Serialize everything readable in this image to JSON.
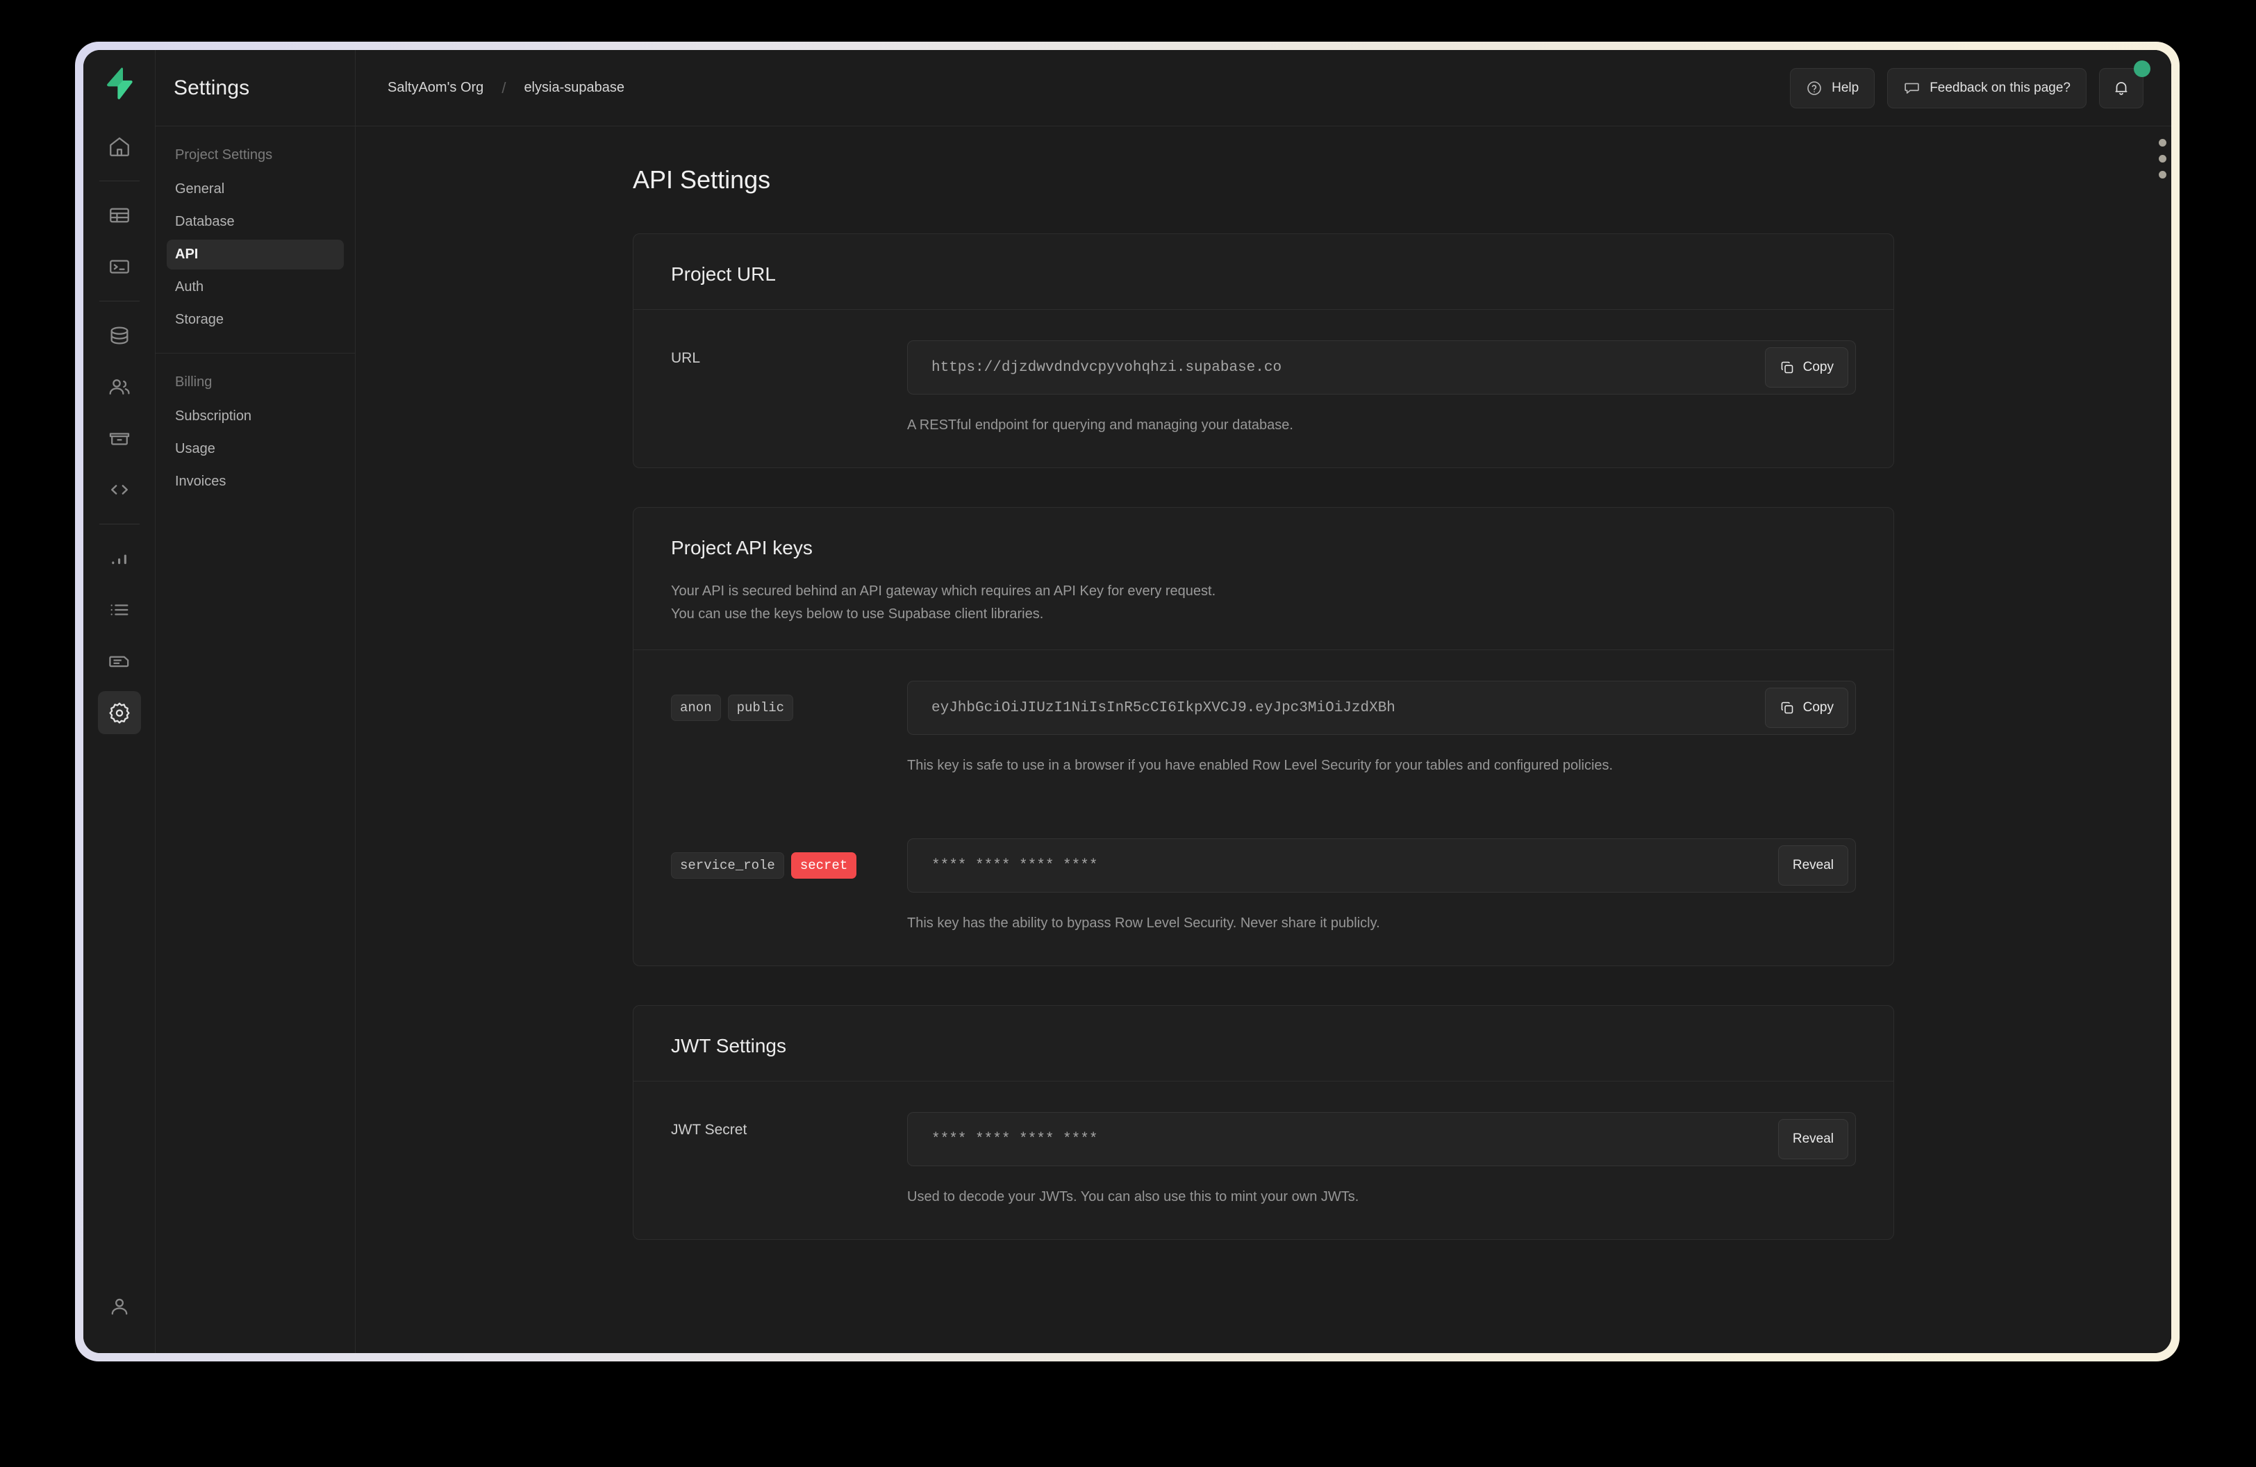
{
  "window": {
    "frame_gradient_left": "#d9d9ef",
    "frame_gradient_right": "#f8f2df"
  },
  "icon_rail": {
    "logo": "supabase-logo",
    "items": [
      {
        "name": "home-icon",
        "label": "Home"
      },
      {
        "name": "table-editor-icon",
        "label": "Table Editor"
      },
      {
        "name": "sql-editor-icon",
        "label": "SQL Editor"
      },
      {
        "name": "database-icon",
        "label": "Database"
      },
      {
        "name": "authentication-icon",
        "label": "Authentication"
      },
      {
        "name": "storage-icon",
        "label": "Storage"
      },
      {
        "name": "api-icon",
        "label": "API"
      },
      {
        "name": "reports-icon",
        "label": "Reports"
      },
      {
        "name": "logs-icon",
        "label": "Logs"
      },
      {
        "name": "docs-icon",
        "label": "Docs"
      },
      {
        "name": "settings-gear-icon",
        "label": "Settings"
      }
    ],
    "active_item": "settings-gear-icon",
    "account_item": {
      "name": "account-icon",
      "label": "Account"
    }
  },
  "sidebar": {
    "title": "Settings",
    "groups": [
      {
        "heading": "Project Settings",
        "items": [
          {
            "label": "General",
            "active": false
          },
          {
            "label": "Database",
            "active": false
          },
          {
            "label": "API",
            "active": true
          },
          {
            "label": "Auth",
            "active": false
          },
          {
            "label": "Storage",
            "active": false
          }
        ]
      },
      {
        "heading": "Billing",
        "items": [
          {
            "label": "Subscription",
            "active": false
          },
          {
            "label": "Usage",
            "active": false
          },
          {
            "label": "Invoices",
            "active": false
          }
        ]
      }
    ]
  },
  "topbar": {
    "breadcrumb": {
      "org": "SaltyAom's Org",
      "separator": "/",
      "project": "elysia-supabase"
    },
    "help_label": "Help",
    "feedback_label": "Feedback on this page?",
    "notification_dot_color": "#34a97b"
  },
  "page": {
    "title": "API Settings"
  },
  "project_url_card": {
    "title": "Project URL",
    "row_label": "URL",
    "url_value": "https://djzdwvdndvcpyvohqhzi.supabase.co",
    "copy_label": "Copy",
    "help_text": "A RESTful endpoint for querying and managing your database."
  },
  "api_keys_card": {
    "title": "Project API keys",
    "desc_line_1": "Your API is secured behind an API gateway which requires an API Key for every request.",
    "desc_line_2": "You can use the keys below to use Supabase client libraries.",
    "anon_row": {
      "badges": [
        "anon",
        "public"
      ],
      "key_value": "eyJhbGciOiJIUzI1NiIsInR5cCI6IkpXVCJ9.eyJpc3MiOiJzdXBh",
      "copy_label": "Copy",
      "help_text": "This key is safe to use in a browser if you have enabled Row Level Security for your tables and configured policies."
    },
    "service_role_row": {
      "badges": [
        "service_role",
        "secret"
      ],
      "badge_danger_color": "#f2494b",
      "key_value": "**** **** **** ****",
      "reveal_label": "Reveal",
      "help_text": "This key has the ability to bypass Row Level Security. Never share it publicly."
    }
  },
  "jwt_card": {
    "title": "JWT Settings",
    "row_label": "JWT Secret",
    "secret_value": "**** **** **** ****",
    "reveal_label": "Reveal",
    "help_text": "Used to decode your JWTs. You can also use this to mint your own JWTs."
  }
}
